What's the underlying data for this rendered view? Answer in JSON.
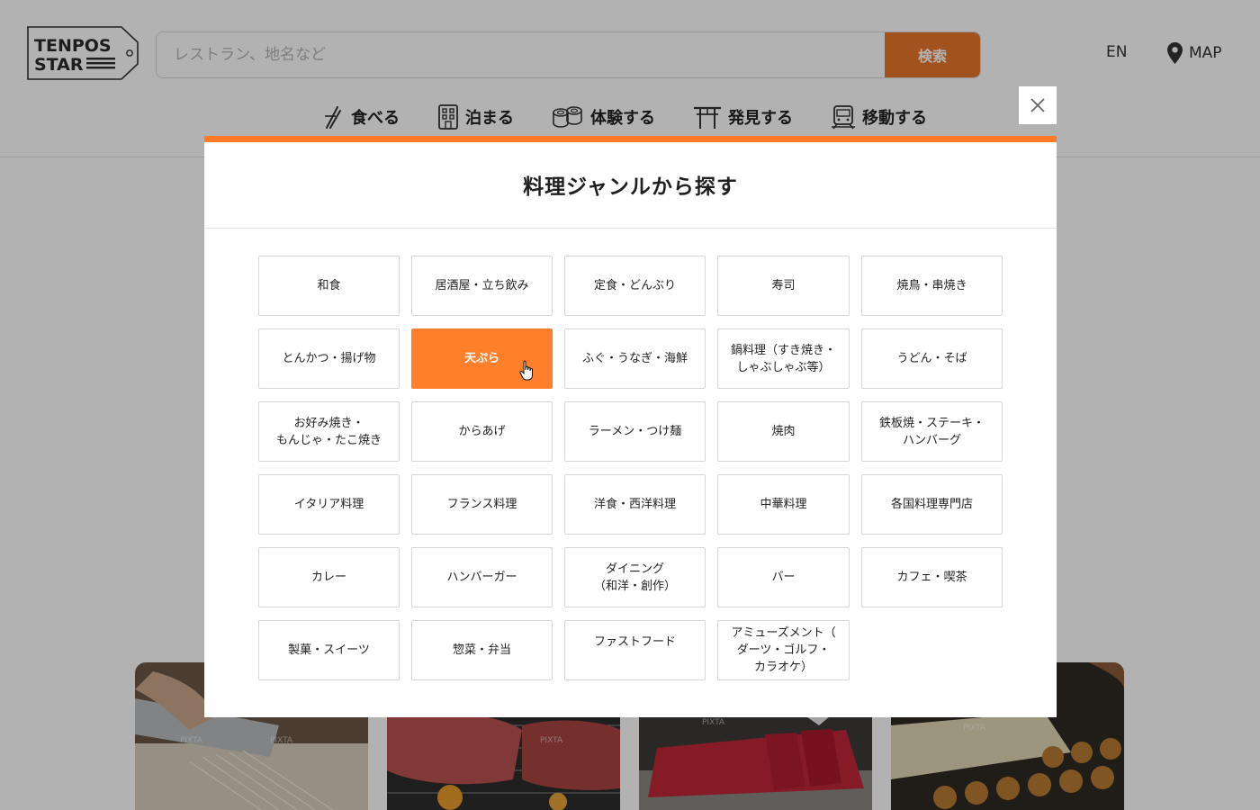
{
  "header": {
    "logo_line1": "TENPOS",
    "logo_line2": "STAR",
    "search_placeholder": "レストラン、地名など",
    "search_button": "検索",
    "lang": "EN",
    "map": "MAP"
  },
  "nav": {
    "items": [
      {
        "label": "食べる",
        "icon": "chopsticks-icon"
      },
      {
        "label": "泊まる",
        "icon": "building-icon"
      },
      {
        "label": "体験する",
        "icon": "sushi-roll-icon"
      },
      {
        "label": "発見する",
        "icon": "torii-gate-icon"
      },
      {
        "label": "移動する",
        "icon": "train-icon"
      }
    ]
  },
  "modal": {
    "title": "料理ジャンルから探す",
    "active_genre": "天ぷら",
    "genres": [
      "和食",
      "居酒屋・立ち飲み",
      "定食・どんぶり",
      "寿司",
      "焼鳥・串焼き",
      "とんかつ・揚げ物",
      "天ぷら",
      "ふぐ・うなぎ・海鮮",
      "鍋料理（すき焼き・\nしゃぶしゃぶ等）",
      "うどん・そば",
      "お好み焼き・\nもんじゃ・たこ焼き",
      "からあげ",
      "ラーメン・つけ麺",
      "焼肉",
      "鉄板焼・ステーキ・\nハンバーグ",
      "イタリア料理",
      "フランス料理",
      "洋食・西洋料理",
      "中華料理",
      "各国料理専門店",
      "カレー",
      "ハンバーガー",
      "ダイニング\n（和洋・創作）",
      "バー",
      "カフェ・喫茶",
      "製菓・スイーツ",
      "惣菜・弁当",
      "ファストフード",
      "アミューズメント（\nダーツ・ゴルフ・\nカラオケ）"
    ]
  },
  "photos": {
    "watermark": "PIXTA",
    "subjects": [
      "soba-cutting",
      "wagyu-grill",
      "tuna-slicing",
      "takoyaki"
    ]
  },
  "colors": {
    "accent": "#ff7a29",
    "search_button": "#e8762a",
    "overlay": "rgba(0,0,0,0.30)"
  }
}
